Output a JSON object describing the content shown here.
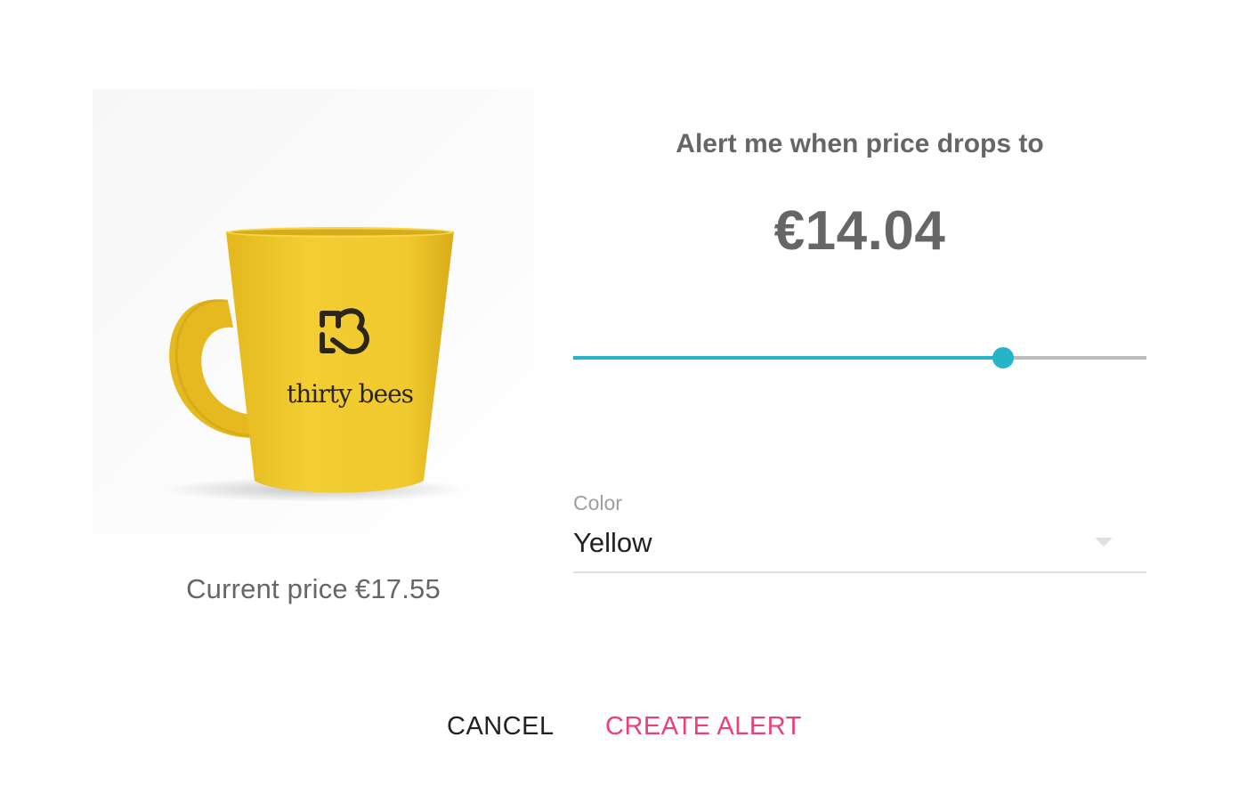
{
  "product": {
    "image_icon": "product-mug-image",
    "brand_text": "thirty bees",
    "current_price_label": "Current price",
    "current_price_value": "€17.55"
  },
  "alert": {
    "heading": "Alert me when price drops to",
    "target_price": "€14.04",
    "slider_fraction": 0.75
  },
  "variant": {
    "label": "Color",
    "selected_value": "Yellow"
  },
  "actions": {
    "cancel_label": "CANCEL",
    "create_label": "CREATE ALERT"
  },
  "colors": {
    "accent": "#26b5c8",
    "primary_action": "#ec407a",
    "heading_text": "#666666",
    "track": "#bdbdbd"
  }
}
